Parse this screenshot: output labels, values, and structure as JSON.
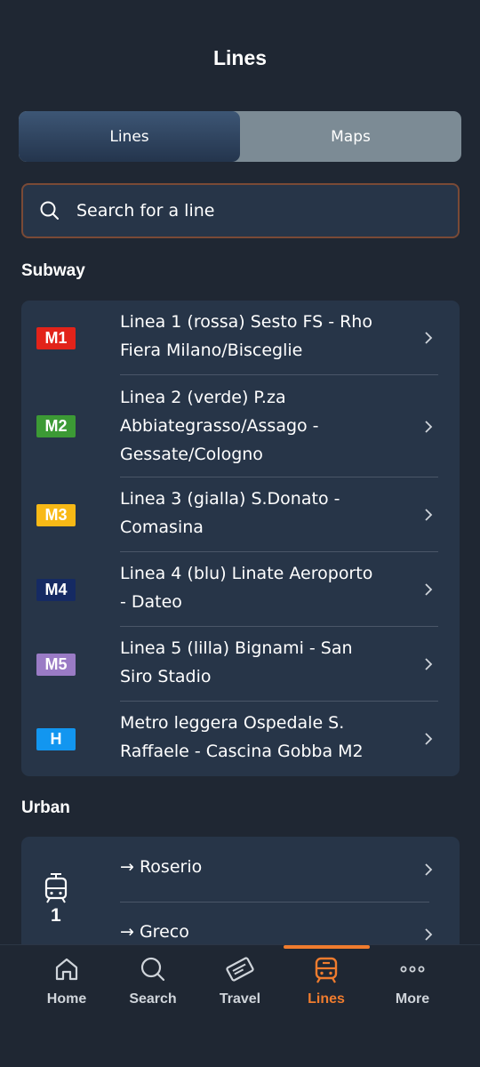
{
  "header": {
    "title": "Lines"
  },
  "tabs": [
    {
      "label": "Lines",
      "active": true
    },
    {
      "label": "Maps",
      "active": false
    }
  ],
  "search": {
    "placeholder": "Search for a line"
  },
  "subway": {
    "title": "Subway",
    "lines": [
      {
        "badge": "M1",
        "badge_color": "#e2231a",
        "text_line1": "Linea 1 (rossa) Sesto FS - Rho",
        "text_line2": "Fiera Milano/Bisceglie",
        "text_line3": ""
      },
      {
        "badge": "M2",
        "badge_color": "#3c9a35",
        "text_line1": "Linea 2 (verde) P.za",
        "text_line2": "Abbiategrasso/Assago -",
        "text_line3": "Gessate/Cologno"
      },
      {
        "badge": "M3",
        "badge_color": "#f8b916",
        "text_line1": "Linea 3 (gialla) S.Donato -",
        "text_line2": "Comasina",
        "text_line3": ""
      },
      {
        "badge": "M4",
        "badge_color": "#152a63",
        "text_line1": "Linea 4 (blu) Linate Aeroporto",
        "text_line2": "- Dateo",
        "text_line3": ""
      },
      {
        "badge": "M5",
        "badge_color": "#9a7bc5",
        "text_line1": "Linea 5 (lilla) Bignami - San",
        "text_line2": "Siro Stadio",
        "text_line3": ""
      },
      {
        "badge": "H",
        "badge_color": "#1296f0",
        "text_line1": "Metro leggera Ospedale S.",
        "text_line2": "Raffaele - Cascina Gobba M2",
        "text_line3": ""
      }
    ]
  },
  "urban": {
    "title": "Urban",
    "line_number": "1",
    "directions": [
      "→ Roserio",
      "→ Greco"
    ]
  },
  "bottom_nav": [
    {
      "label": "Home",
      "icon": "home-icon",
      "active": false
    },
    {
      "label": "Search",
      "icon": "search-icon",
      "active": false
    },
    {
      "label": "Travel",
      "icon": "ticket-icon",
      "active": false
    },
    {
      "label": "Lines",
      "icon": "tram-icon",
      "active": true
    },
    {
      "label": "More",
      "icon": "more-icon",
      "active": false
    }
  ],
  "colors": {
    "accent": "#f07c2e",
    "background": "#1f2733",
    "card": "#273548"
  }
}
